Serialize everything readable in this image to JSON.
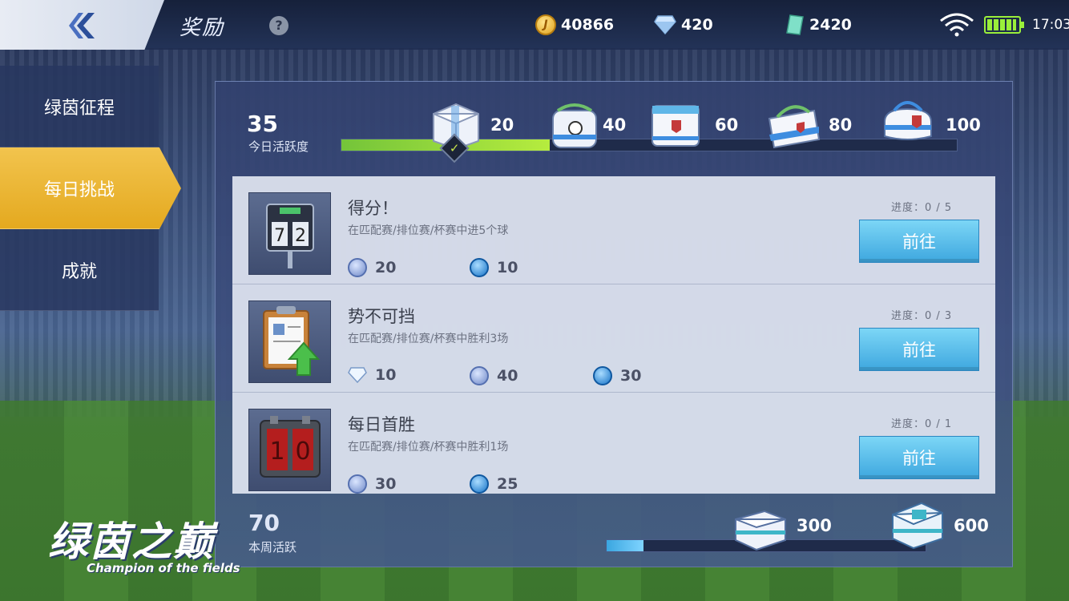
{
  "header": {
    "title": "奖励",
    "help_icon": "?",
    "coins": "40866",
    "diamonds": "420",
    "tickets": "2420",
    "time": "17:03",
    "coin_symbol": "J"
  },
  "sidebar": {
    "items": [
      {
        "label": "绿茵征程",
        "active": false
      },
      {
        "label": "每日挑战",
        "active": true
      },
      {
        "label": "成就",
        "active": false
      }
    ]
  },
  "daily": {
    "score": "35",
    "label": "今日活跃度",
    "progress_fraction": 0.35,
    "milestones": [
      "20",
      "40",
      "60",
      "80",
      "100"
    ]
  },
  "tasks": [
    {
      "title": "得分！",
      "desc": "在匹配赛/排位赛/杯赛中进5个球",
      "progress": "进度：0 / 5",
      "button": "前往",
      "rewards": [
        {
          "icon": "exp-icon",
          "value": "20"
        },
        {
          "icon": "ball-icon",
          "value": "10"
        }
      ]
    },
    {
      "title": "势不可挡",
      "desc": "在匹配赛/排位赛/杯赛中胜利3场",
      "progress": "进度：0 / 3",
      "button": "前往",
      "rewards": [
        {
          "icon": "diamond-icon",
          "value": "10"
        },
        {
          "icon": "exp-icon",
          "value": "40"
        },
        {
          "icon": "ball-icon",
          "value": "30"
        }
      ]
    },
    {
      "title": "每日首胜",
      "desc": "在匹配赛/排位赛/杯赛中胜利1场",
      "progress": "进度：0 / 1",
      "button": "前往",
      "rewards": [
        {
          "icon": "exp-icon",
          "value": "30"
        },
        {
          "icon": "ball-icon",
          "value": "25"
        }
      ]
    }
  ],
  "weekly": {
    "score": "70",
    "label": "本周活跃",
    "milestones": [
      "300",
      "600"
    ],
    "progress_fraction": 0.117
  },
  "logo": {
    "cn": "绿茵之巅",
    "en": "Champion of the fields"
  }
}
